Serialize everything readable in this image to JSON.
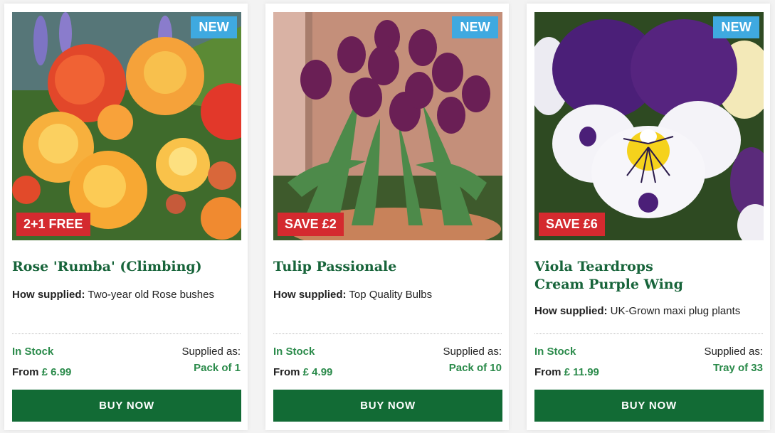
{
  "products": [
    {
      "badge_new": "NEW",
      "offer": "2+1 FREE",
      "title": "Rose 'Rumba' (Climbing)",
      "supplied_label": "How supplied:",
      "supplied_value": "Two-year old Rose bushes",
      "stock": "In Stock",
      "price_prefix": "From",
      "price": "£ 6.99",
      "supplied_as_label": "Supplied as:",
      "pack": "Pack of 1",
      "buy_label": "BUY NOW",
      "image_icon": "rose-photo"
    },
    {
      "badge_new": "NEW",
      "offer": "SAVE £2",
      "title": "Tulip Passionale",
      "supplied_label": "How supplied:",
      "supplied_value": "Top Quality Bulbs",
      "stock": "In Stock",
      "price_prefix": "From",
      "price": "£ 4.99",
      "supplied_as_label": "Supplied as:",
      "pack": "Pack of 10",
      "buy_label": "BUY NOW",
      "image_icon": "tulip-photo"
    },
    {
      "badge_new": "NEW",
      "offer": "SAVE £6",
      "title": "Viola Teardrops Cream Purple Wing",
      "supplied_label": "How supplied:",
      "supplied_value": "UK-Grown maxi plug plants",
      "stock": "In Stock",
      "price_prefix": "From",
      "price": "£ 11.99",
      "supplied_as_label": "Supplied as:",
      "pack": "Tray of 33",
      "buy_label": "BUY NOW",
      "image_icon": "viola-photo"
    }
  ],
  "colors": {
    "title_green": "#17643a",
    "stock_green": "#2a8a4a",
    "button_green": "#126b35",
    "new_badge_blue": "#3fa9e0",
    "offer_badge_red": "#d42a2f"
  }
}
